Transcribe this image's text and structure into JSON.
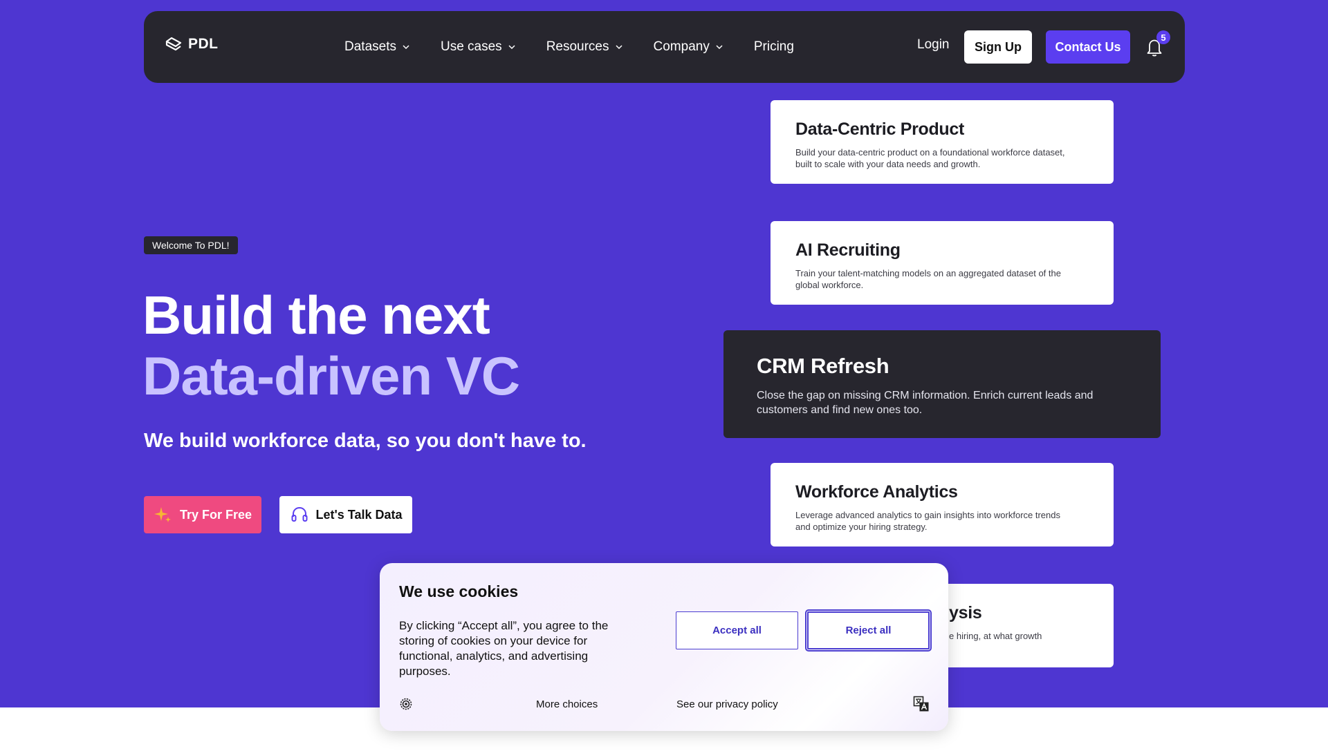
{
  "brand": {
    "name": "PDL"
  },
  "nav": {
    "items": [
      {
        "label": "Datasets",
        "has_dropdown": true
      },
      {
        "label": "Use cases",
        "has_dropdown": true
      },
      {
        "label": "Resources",
        "has_dropdown": true
      },
      {
        "label": "Company",
        "has_dropdown": true
      },
      {
        "label": "Pricing",
        "has_dropdown": false
      }
    ],
    "login_label": "Login",
    "signup_label": "Sign Up",
    "contact_label": "Contact Us",
    "notification_count": "5"
  },
  "hero": {
    "badge": "Welcome To PDL!",
    "headline_line1": "Build the next",
    "headline_line2": "Data-driven VC",
    "subheadline": "We build workforce data, so you don't have to.",
    "try_label": "Try For Free",
    "talk_label": "Let's Talk Data"
  },
  "cards": [
    {
      "title": "Data-Centric Product",
      "description": "Build your data-centric product on a foundational workforce dataset, built to scale with your data needs and growth."
    },
    {
      "title": "AI Recruiting",
      "description": "Train your talent-matching models on an aggregated dataset of the global workforce."
    },
    {
      "title": "CRM Refresh",
      "description": "Close the gap on missing CRM information. Enrich current leads and customers and find new ones too."
    },
    {
      "title": "Workforce Analytics",
      "description": "Leverage advanced analytics to gain insights into workforce trends and optimize your hiring strategy."
    },
    {
      "title_partial": "ysis",
      "description_partial": "e hiring, at what growth"
    }
  ],
  "cookie": {
    "title": "We use cookies",
    "body": "By clicking “Accept all”, you agree to the storing of cookies on your device for functional, analytics, and advertising purposes.",
    "accept_label": "Accept all",
    "reject_label": "Reject all",
    "more_choices_label": "More choices",
    "privacy_label": "See our privacy policy"
  },
  "colors": {
    "hero_bg": "#4e36d1",
    "nav_bg": "#27262e",
    "accent": "#5b3ef0",
    "headline_accent": "#c9c3ff",
    "try_button": "#ef4a80"
  },
  "icons": [
    "logo-icon",
    "chevron-down-icon",
    "bell-icon",
    "sparkle-icon",
    "headset-icon",
    "gear-icon",
    "translate-icon"
  ]
}
